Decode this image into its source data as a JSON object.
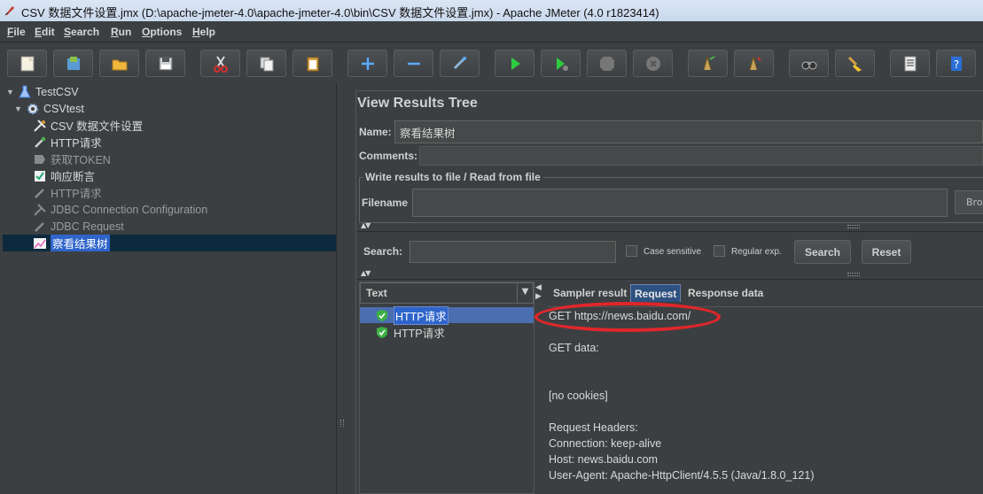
{
  "window": {
    "title": "CSV 数据文件设置.jmx (D:\\apache-jmeter-4.0\\apache-jmeter-4.0\\bin\\CSV 数据文件设置.jmx) - Apache JMeter (4.0 r1823414)"
  },
  "menu": [
    "File",
    "Edit",
    "Search",
    "Run",
    "Options",
    "Help"
  ],
  "toolbar": {
    "buttons": [
      {
        "name": "new-icon"
      },
      {
        "name": "templates-icon"
      },
      {
        "name": "open-icon"
      },
      {
        "name": "save-icon"
      },
      {
        "name": "cut-icon"
      },
      {
        "name": "copy-icon"
      },
      {
        "name": "paste-icon"
      },
      {
        "name": "expand-icon"
      },
      {
        "name": "collapse-icon"
      },
      {
        "name": "toggle-icon"
      },
      {
        "name": "start-icon"
      },
      {
        "name": "start-no-pauses-icon"
      },
      {
        "name": "stop-icon"
      },
      {
        "name": "shutdown-icon"
      },
      {
        "name": "remote-start-icon"
      },
      {
        "name": "remote-stop-icon"
      },
      {
        "name": "search-binoculars-icon"
      },
      {
        "name": "clear-broom-icon"
      },
      {
        "name": "function-helper-icon"
      },
      {
        "name": "help-icon"
      }
    ]
  },
  "tree": {
    "nodes": [
      {
        "label": "TestCSV",
        "icon": "test-plan-icon",
        "level": 0,
        "expanded": true,
        "disabled": false,
        "selected": false
      },
      {
        "label": "CSVtest",
        "icon": "thread-group-gear-icon",
        "level": 1,
        "expanded": true,
        "disabled": false,
        "selected": false
      },
      {
        "label": "CSV 数据文件设置",
        "icon": "config-wrench-icon",
        "level": 2,
        "disabled": false,
        "selected": false
      },
      {
        "label": "HTTP请求",
        "icon": "sampler-pipette-icon",
        "level": 2,
        "disabled": false,
        "selected": false
      },
      {
        "label": "获取TOKEN",
        "icon": "post-processor-icon",
        "level": 2,
        "disabled": true,
        "selected": false
      },
      {
        "label": "响应断言",
        "icon": "assertion-icon",
        "level": 2,
        "disabled": false,
        "selected": false
      },
      {
        "label": "HTTP请求",
        "icon": "sampler-pipette-icon",
        "level": 2,
        "disabled": true,
        "selected": false
      },
      {
        "label": "JDBC Connection Configuration",
        "icon": "config-wrench-icon",
        "level": 2,
        "disabled": true,
        "selected": false
      },
      {
        "label": "JDBC Request",
        "icon": "sampler-pipette-icon",
        "level": 2,
        "disabled": true,
        "selected": false
      },
      {
        "label": "察看结果树",
        "icon": "listener-graph-icon",
        "level": 2,
        "disabled": false,
        "selected": true
      }
    ]
  },
  "panel": {
    "title": "View Results Tree",
    "name_label": "Name:",
    "name_value": "察看结果树",
    "comments_label": "Comments:",
    "file_group_title": "Write results to file / Read from file",
    "filename_label": "Filename",
    "filename_value": "",
    "browse_label": "Browse..."
  },
  "search": {
    "label": "Search:",
    "value": "",
    "case_sensitive_label": "Case sensitive",
    "case_sensitive_checked": false,
    "regex_label": "Regular exp.",
    "regex_checked": false,
    "search_button": "Search",
    "reset_button": "Reset"
  },
  "results": {
    "renderer": "Text",
    "items": [
      {
        "label": "HTTP请求",
        "status": "success",
        "selected": true
      },
      {
        "label": "HTTP请求",
        "status": "success",
        "selected": false
      }
    ]
  },
  "detail": {
    "tabs": [
      {
        "label": "Sampler result",
        "active": false
      },
      {
        "label": "Request",
        "active": true
      },
      {
        "label": "Response data",
        "active": false
      }
    ],
    "lines": [
      "GET https://news.baidu.com/",
      "",
      "GET data:",
      "",
      "",
      "[no cookies]",
      "",
      "Request Headers:",
      "Connection: keep-alive",
      "Host: news.baidu.com",
      "User-Agent: Apache-HttpClient/4.5.5 (Java/1.8.0_121)"
    ],
    "highlight_color": "#e0262b"
  },
  "colors": {
    "background": "#3c3f41",
    "selection": "#2f65ca",
    "success": "#3cb043"
  }
}
